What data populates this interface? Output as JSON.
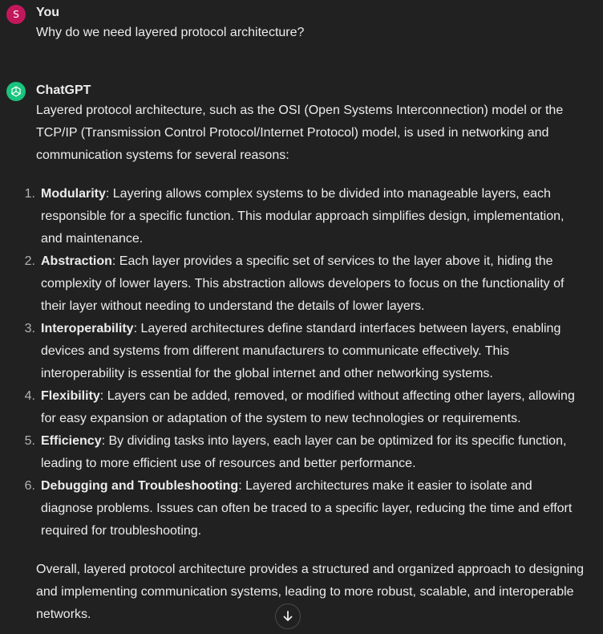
{
  "user_message": {
    "avatar_initial": "S",
    "author": "You",
    "text": "Why do we need layered protocol architecture?"
  },
  "assistant_message": {
    "author": "ChatGPT",
    "icon": "openai-logo-icon",
    "intro": "Layered protocol architecture, such as the OSI (Open Systems Interconnection) model or the TCP/IP (Transmission Control Protocol/Internet Protocol) model, is used in networking and communication systems for several reasons:",
    "points": [
      {
        "num": "1.",
        "title": "Modularity",
        "text": ": Layering allows complex systems to be divided into manageable layers, each responsible for a specific function. This modular approach simplifies design, implementation, and maintenance."
      },
      {
        "num": "2.",
        "title": "Abstraction",
        "text": ": Each layer provides a specific set of services to the layer above it, hiding the complexity of lower layers. This abstraction allows developers to focus on the functionality of their layer without needing to understand the details of lower layers."
      },
      {
        "num": "3.",
        "title": "Interoperability",
        "text": ": Layered architectures define standard interfaces between layers, enabling devices and systems from different manufacturers to communicate effectively. This interoperability is essential for the global internet and other networking systems."
      },
      {
        "num": "4.",
        "title": "Flexibility",
        "text": ": Layers can be added, removed, or modified without affecting other layers, allowing for easy expansion or adaptation of the system to new technologies or requirements."
      },
      {
        "num": "5.",
        "title": "Efficiency",
        "text": ": By dividing tasks into layers, each layer can be optimized for its specific function, leading to more efficient use of resources and better performance."
      },
      {
        "num": "6.",
        "title": "Debugging and Troubleshooting",
        "text": ": Layered architectures make it easier to isolate and diagnose problems. Issues can often be traced to a specific layer, reducing the time and effort required for troubleshooting."
      }
    ],
    "conclusion": "Overall, layered protocol architecture provides a structured and organized approach to designing and implementing communication systems, leading to more robust, scalable, and interoperable networks."
  },
  "scroll_button_icon": "arrow-down-icon",
  "colors": {
    "background": "#212121",
    "text": "#ececec",
    "user_avatar": "#c2185b",
    "assistant_avatar": "#19c37d"
  }
}
